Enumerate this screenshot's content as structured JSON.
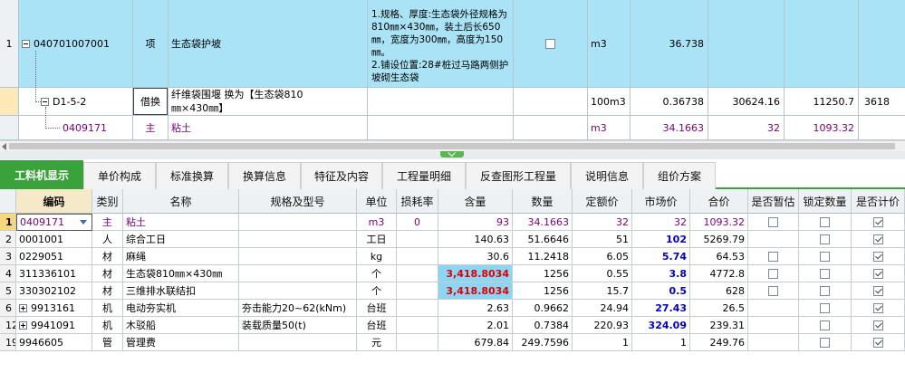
{
  "top_grid": {
    "rows": [
      {
        "num": "1",
        "code": "040701007001",
        "type": "项",
        "name": "生态袋护坡",
        "desc": "1.规格、厚度:生态袋外径规格为810㎜×430㎜，装土后长650㎜，宽度为300㎜，高度为150㎜。\n2.铺设位置:28#桩过马路两侧护坡砌生态袋",
        "checked": false,
        "unit": "m3",
        "qty": "36.738",
        "price": "",
        "total": "",
        "extra": ""
      },
      {
        "num": "",
        "code": "D1-5-2",
        "type": "借换",
        "name": "纤维袋围堰 换为【生态袋810㎜×430㎜】",
        "desc": "",
        "unit": "100m3",
        "qty": "0.36738",
        "price": "30624.16",
        "total": "11250.7",
        "extra": "3618"
      },
      {
        "num": "",
        "code": "0409171",
        "type": "主",
        "name": "粘土",
        "desc": "",
        "unit": "m3",
        "qty": "34.1663",
        "price": "32",
        "total": "1093.32",
        "extra": ""
      }
    ]
  },
  "tabs": [
    {
      "label": "工料机显示",
      "active": true
    },
    {
      "label": "单价构成",
      "active": false
    },
    {
      "label": "标准换算",
      "active": false
    },
    {
      "label": "换算信息",
      "active": false
    },
    {
      "label": "特征及内容",
      "active": false
    },
    {
      "label": "工程量明细",
      "active": false
    },
    {
      "label": "反查图形工程量",
      "active": false
    },
    {
      "label": "说明信息",
      "active": false
    },
    {
      "label": "组价方案",
      "active": false
    }
  ],
  "bottom_grid": {
    "headers": [
      "",
      "编码",
      "类别",
      "名称",
      "规格及型号",
      "单位",
      "损耗率",
      "含量",
      "数量",
      "定额价",
      "市场价",
      "合价",
      "是否暂估",
      "锁定数量",
      "是否计价"
    ],
    "rows": [
      {
        "num": "1",
        "code": "0409171",
        "cat": "主",
        "name": "粘土",
        "spec": "",
        "unit": "m3",
        "loss": "0",
        "content": "93",
        "qty": "34.1663",
        "quota": "32",
        "market": "32",
        "total": "1093.32",
        "est": false,
        "lock": false,
        "priced": true,
        "expand": ""
      },
      {
        "num": "2",
        "code": "0001001",
        "cat": "人",
        "name": "综合工日",
        "spec": "",
        "unit": "工日",
        "loss": "",
        "content": "140.63",
        "qty": "51.6646",
        "quota": "51",
        "market": "102",
        "total": "5269.79",
        "est": null,
        "lock": false,
        "priced": true,
        "expand": ""
      },
      {
        "num": "3",
        "code": "0229051",
        "cat": "材",
        "name": "麻绳",
        "spec": "",
        "unit": "kg",
        "loss": "",
        "content": "30.6",
        "qty": "11.2418",
        "quota": "6.05",
        "market": "5.74",
        "total": "64.53",
        "est": false,
        "lock": false,
        "priced": true,
        "expand": ""
      },
      {
        "num": "4",
        "code": "311336101",
        "cat": "材",
        "name": "生态袋810㎜×430㎜",
        "spec": "",
        "unit": "个",
        "loss": "",
        "content": "3,418.8034",
        "qty": "1256",
        "quota": "0.55",
        "market": "3.8",
        "total": "4772.8",
        "est": false,
        "lock": false,
        "priced": true,
        "expand": ""
      },
      {
        "num": "5",
        "code": "330302102",
        "cat": "材",
        "name": "三维排水联结扣",
        "spec": "",
        "unit": "个",
        "loss": "",
        "content": "3,418.8034",
        "qty": "1256",
        "quota": "15.7",
        "market": "0.5",
        "total": "628",
        "est": false,
        "lock": false,
        "priced": true,
        "expand": ""
      },
      {
        "num": "6",
        "code": "9913161",
        "cat": "机",
        "name": "电动夯实机",
        "spec": "夯击能力20~62(kNm)",
        "unit": "台班",
        "loss": "",
        "content": "2.63",
        "qty": "0.9662",
        "quota": "24.94",
        "market": "27.43",
        "total": "26.5",
        "est": null,
        "lock": false,
        "priced": true,
        "expand": "+"
      },
      {
        "num": "12",
        "code": "9941091",
        "cat": "机",
        "name": "木驳船",
        "spec": "装载质量50(t)",
        "unit": "台班",
        "loss": "",
        "content": "2.01",
        "qty": "0.7384",
        "quota": "220.93",
        "market": "324.09",
        "total": "239.31",
        "est": null,
        "lock": false,
        "priced": true,
        "expand": "+"
      },
      {
        "num": "19",
        "code": "9946605",
        "cat": "管",
        "name": "管理费",
        "spec": "",
        "unit": "元",
        "loss": "",
        "content": "679.84",
        "qty": "249.7596",
        "quota": "1",
        "market": "1",
        "total": "249.76",
        "est": null,
        "lock": false,
        "priced": true,
        "expand": ""
      }
    ]
  },
  "colors": {
    "accent": "#3aa23a",
    "selected_row": "#a9e3f5",
    "changed_market": "#0000d0",
    "changed_content": "#e00000",
    "main_material": "#800080"
  }
}
